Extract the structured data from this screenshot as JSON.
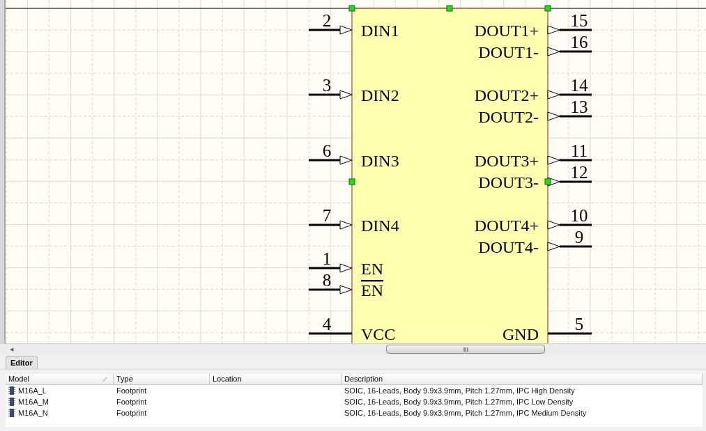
{
  "component": {
    "selected": true,
    "left_pins": [
      {
        "kind": "input",
        "number": "2",
        "name": "DIN1",
        "inverted": false
      },
      {
        "kind": "input",
        "number": "3",
        "name": "DIN2",
        "inverted": false
      },
      {
        "kind": "input",
        "number": "6",
        "name": "DIN3",
        "inverted": false
      },
      {
        "kind": "input",
        "number": "7",
        "name": "DIN4",
        "inverted": false
      },
      {
        "kind": "input",
        "number": "1",
        "name": "EN",
        "inverted": false
      },
      {
        "kind": "input",
        "number": "8",
        "name": "EN",
        "inverted": true
      },
      {
        "kind": "power",
        "number": "4",
        "name": "VCC",
        "inverted": false
      }
    ],
    "right_pins": [
      {
        "kind": "output",
        "number": "15",
        "name": "DOUT1+",
        "inverted": false
      },
      {
        "kind": "output",
        "number": "16",
        "name": "DOUT1-",
        "inverted": false
      },
      {
        "kind": "output",
        "number": "14",
        "name": "DOUT2+",
        "inverted": false
      },
      {
        "kind": "output",
        "number": "13",
        "name": "DOUT2-",
        "inverted": false
      },
      {
        "kind": "output",
        "number": "11",
        "name": "DOUT3+",
        "inverted": false
      },
      {
        "kind": "output",
        "number": "12",
        "name": "DOUT3-",
        "inverted": false
      },
      {
        "kind": "output",
        "number": "10",
        "name": "DOUT4+",
        "inverted": false
      },
      {
        "kind": "output",
        "number": "9",
        "name": "DOUT4-",
        "inverted": false
      },
      {
        "kind": "power",
        "number": "5",
        "name": "GND",
        "inverted": false
      }
    ]
  },
  "scrollbar": {
    "left_arrow": "◀"
  },
  "tabs": [
    {
      "label": "Editor",
      "selected": true
    }
  ],
  "table": {
    "columns": [
      {
        "label": "Model",
        "sorted": true
      },
      {
        "label": "Type",
        "sorted": false
      },
      {
        "label": "Location",
        "sorted": false
      },
      {
        "label": "Description",
        "sorted": false
      }
    ],
    "rows": [
      {
        "model": "M16A_L",
        "type": "Footprint",
        "description": "SOIC, 16-Leads, Body 9.9x3.9mm, Pitch 1.27mm, IPC High Density"
      },
      {
        "model": "M16A_M",
        "type": "Footprint",
        "description": "SOIC, 16-Leads, Body 9.9x3.9mm, Pitch 1.27mm, IPC Low Density"
      },
      {
        "model": "M16A_N",
        "type": "Footprint",
        "description": "SOIC, 16-Leads, Body 9.9x3.9mm, Pitch 1.27mm, IPC Medium Density"
      }
    ]
  }
}
